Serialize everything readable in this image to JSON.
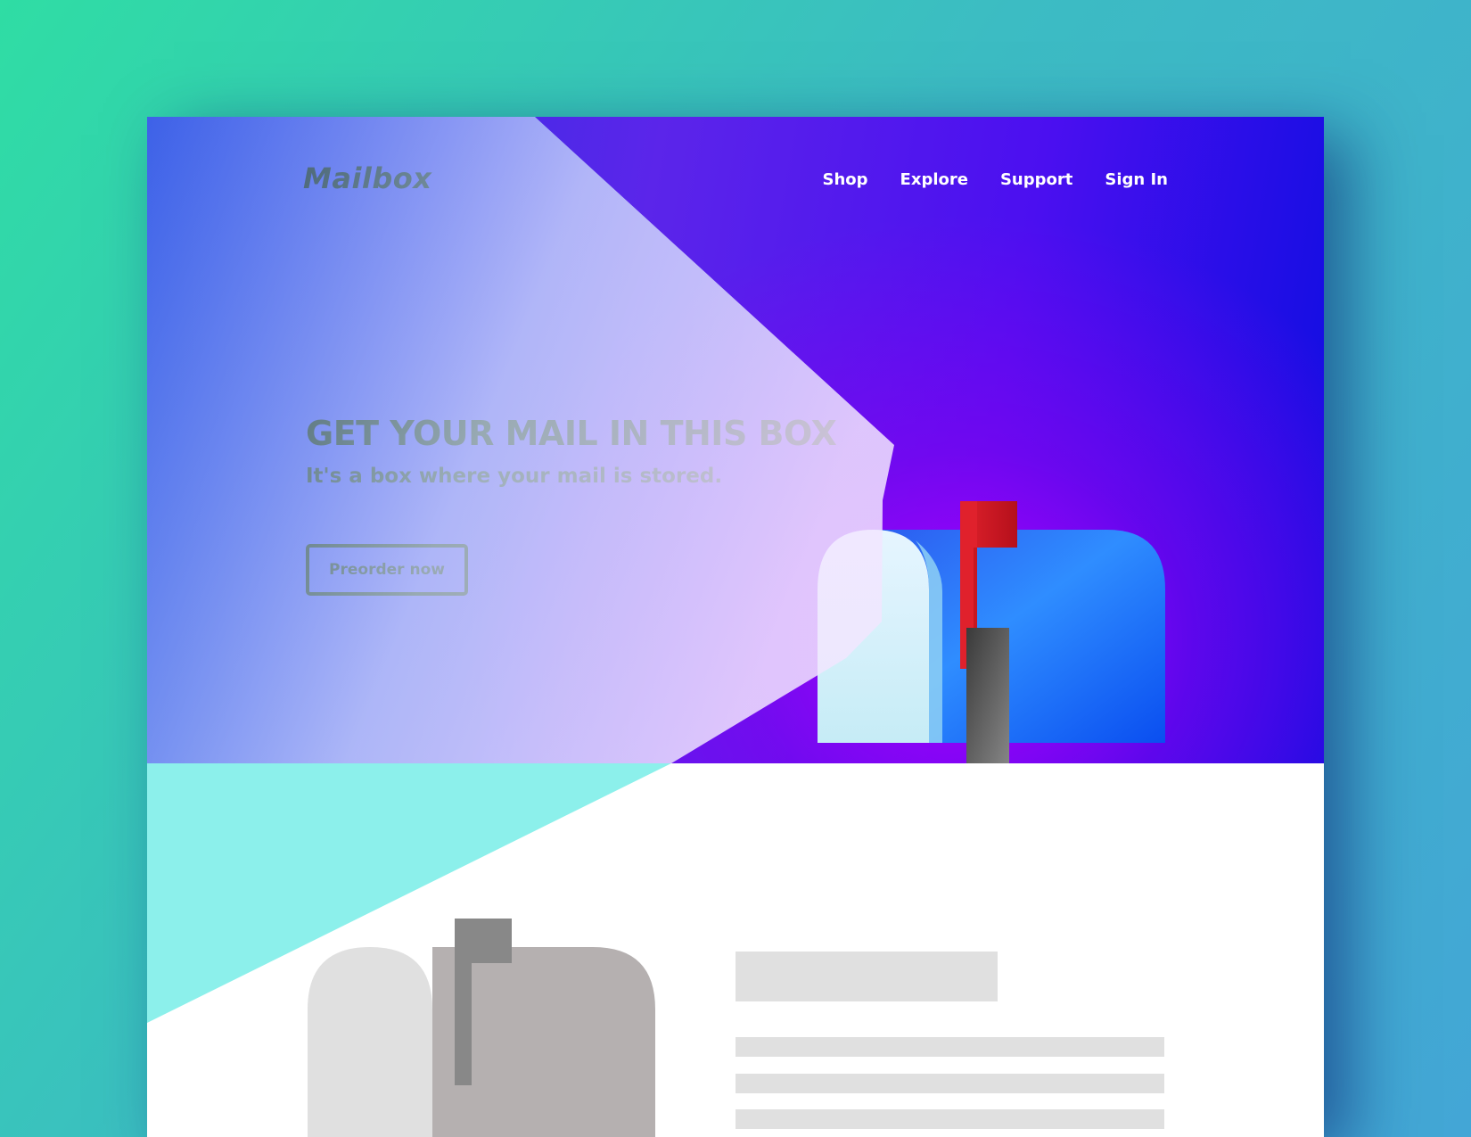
{
  "brand": {
    "logo": "Mailbox"
  },
  "nav": {
    "items": [
      "Shop",
      "Explore",
      "Support",
      "Sign In"
    ]
  },
  "hero": {
    "headline": "GET YOUR MAIL IN THIS BOX",
    "subhead": "It's a box where your mail is stored.",
    "cta_label": "Preorder now",
    "illustration": "mailbox-icon"
  },
  "features": {
    "illustration": "mailbox-icon"
  },
  "colors": {
    "background_start": "#2fdda4",
    "background_end": "#43a6d6",
    "hero_blue": "#2234e0",
    "hero_purple": "#a600ff",
    "beam": "#9bf3ee",
    "mailbox_blue": "#2a8cff",
    "flag_red": "#e0212c",
    "placeholder_gray": "#e0e0e0"
  }
}
